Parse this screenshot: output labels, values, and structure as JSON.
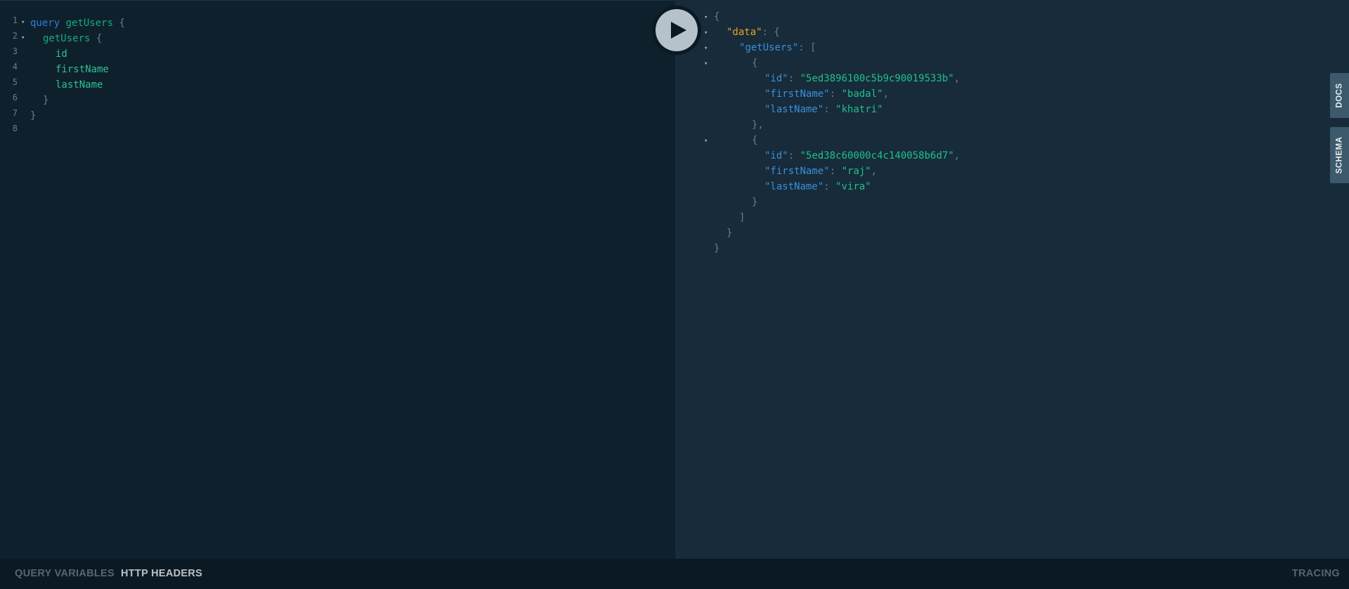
{
  "editor": {
    "line_numbers": [
      "1",
      "2",
      "3",
      "4",
      "5",
      "6",
      "7",
      "8"
    ],
    "query_keyword": "query",
    "operation_name": "getUsers",
    "open_brace": "{",
    "field_root": "getUsers",
    "fields": [
      "id",
      "firstName",
      "lastName"
    ],
    "close_brace": "}",
    "fold_glyph": "▾"
  },
  "run_button": {
    "icon": "play-icon"
  },
  "result": {
    "open": "{",
    "data_key": "\"data\"",
    "colon": ":",
    "getusers_key": "\"getUsers\"",
    "open_bracket": "[",
    "close_bracket": "]",
    "close": "}",
    "comma": ",",
    "users": [
      {
        "id_key": "\"id\"",
        "id": "\"5ed3896100c5b9c90019533b\"",
        "first_key": "\"firstName\"",
        "first": "\"badal\"",
        "last_key": "\"lastName\"",
        "last": "\"khatri\"",
        "obj_close": "},"
      },
      {
        "id_key": "\"id\"",
        "id": "\"5ed38c60000c4c140058b6d7\"",
        "first_key": "\"firstName\"",
        "first": "\"raj\"",
        "last_key": "\"lastName\"",
        "last": "\"vira\"",
        "obj_close": "}"
      }
    ]
  },
  "side_tabs": {
    "docs": "DOCS",
    "schema": "SCHEMA"
  },
  "bottom": {
    "query_variables": "QUERY VARIABLES",
    "http_headers": "HTTP HEADERS",
    "tracing": "TRACING"
  },
  "colors": {
    "editor_bg": "#0f202d",
    "result_bg": "#172b3a",
    "keyword": "#2a7ed3",
    "string": "#21c08b",
    "data_key": "#e5a32c"
  }
}
